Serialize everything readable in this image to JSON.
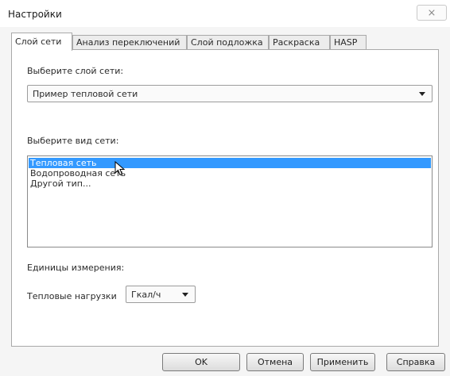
{
  "window": {
    "title": "Настройки",
    "close_symbol": "⨯"
  },
  "tabs": [
    {
      "label": "Слой сети",
      "active": true
    },
    {
      "label": "Анализ переключений",
      "active": false
    },
    {
      "label": "Слой подложка",
      "active": false
    },
    {
      "label": "Раскраска",
      "active": false
    },
    {
      "label": "HASP",
      "active": false
    }
  ],
  "network_layer": {
    "label": "Выберите слой сети:",
    "selected": "Пример тепловой сети"
  },
  "network_type": {
    "label": "Выберите вид сети:",
    "options": [
      "Тепловая сеть",
      "Водопроводная сеть",
      "Другой тип..."
    ],
    "selected_index": 0
  },
  "units": {
    "section_label": "Единицы измерения:",
    "heat_loads_label": "Тепловые нагрузки",
    "heat_loads_value": "Гкал/ч"
  },
  "buttons": {
    "ok": "OK",
    "cancel": "Отмена",
    "apply": "Применить",
    "help": "Справка"
  },
  "colors": {
    "selection": "#3399ff",
    "panel": "#ffffff",
    "chrome": "#f5f5f5"
  }
}
